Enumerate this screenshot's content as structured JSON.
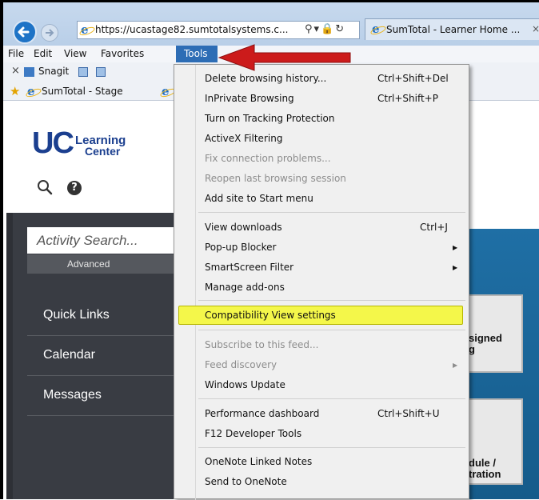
{
  "browser": {
    "url": "https://ucastage82.sumtotalsystems.c...",
    "tab_title": "SumTotal - Learner Home ...",
    "menu": [
      "File",
      "Edit",
      "View",
      "Favorites",
      "Tools"
    ],
    "snagit_label": "Snagit",
    "favorites": [
      "SumTotal - Stage",
      "S"
    ]
  },
  "page": {
    "logo": {
      "uc": "UC",
      "learning": "Learning",
      "center": "Center"
    },
    "search_placeholder": "Activity Search...",
    "advanced_label": "Advanced",
    "nav": [
      "Quick Links",
      "Calendar",
      "Messages"
    ],
    "tiles": [
      {
        "line1": "signed",
        "line2": "g"
      },
      {
        "line1": "dule /",
        "line2": "tration"
      }
    ]
  },
  "tools_menu": {
    "items": [
      {
        "label": "Delete browsing history...",
        "shortcut": "Ctrl+Shift+Del",
        "enabled": true
      },
      {
        "label": "InPrivate Browsing",
        "shortcut": "Ctrl+Shift+P",
        "enabled": true
      },
      {
        "label": "Turn on Tracking Protection",
        "enabled": true
      },
      {
        "label": "ActiveX Filtering",
        "enabled": true
      },
      {
        "label": "Fix connection problems...",
        "enabled": false
      },
      {
        "label": "Reopen last browsing session",
        "enabled": false
      },
      {
        "label": "Add site to Start menu",
        "enabled": true
      },
      {
        "label": "View downloads",
        "shortcut": "Ctrl+J",
        "enabled": true
      },
      {
        "label": "Pop-up Blocker",
        "submenu": true,
        "enabled": true
      },
      {
        "label": "SmartScreen Filter",
        "submenu": true,
        "enabled": true
      },
      {
        "label": "Manage add-ons",
        "enabled": true
      },
      {
        "label": "Compatibility View settings",
        "enabled": true,
        "highlighted": true
      },
      {
        "label": "Subscribe to this feed...",
        "enabled": false
      },
      {
        "label": "Feed discovery",
        "submenu": true,
        "enabled": false
      },
      {
        "label": "Windows Update",
        "enabled": true
      },
      {
        "label": "Performance dashboard",
        "shortcut": "Ctrl+Shift+U",
        "enabled": true
      },
      {
        "label": "F12 Developer Tools",
        "enabled": true
      },
      {
        "label": "OneNote Linked Notes",
        "enabled": true
      },
      {
        "label": "Send to OneNote",
        "enabled": true
      }
    ]
  },
  "colors": {
    "highlight": "#f4f74a",
    "tools_active": "#2d6db5",
    "arrow": "#cc1b1b",
    "sidebar": "#393c43"
  }
}
